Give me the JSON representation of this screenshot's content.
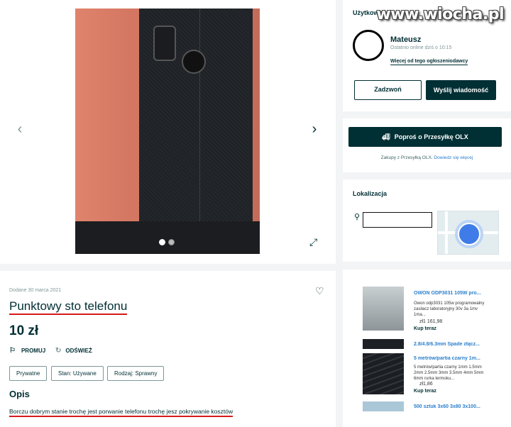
{
  "watermark": "www.wiocha.pl",
  "gallery": {
    "prev_arrow": "‹",
    "next_arrow": "›",
    "expand_icon": "⤢"
  },
  "user": {
    "section_title": "Użytkownik",
    "name": "Mateusz",
    "last_online": "Ostatnio online dziś o 10:15",
    "more_ads_link": "Więcej od tego ogłoszeniodawcy",
    "call_button": "Zadzwoń",
    "message_button": "Wyślij wiadomość"
  },
  "shipping": {
    "button": "Poproś o Przesyłkę OLX",
    "note": "Zakupy z Przesyłką OLX.",
    "note_link": "Dowiedz się więcej"
  },
  "location": {
    "title": "Lokalizacja",
    "address": ""
  },
  "listing": {
    "added_date": "Dodane 30 marca 2021",
    "title": "Punktowy sto telefonu",
    "price": "10 zł",
    "promote_label": "PROMUJ",
    "refresh_label": "ODŚWIEŻ",
    "tags": [
      "Prywatne",
      "Stan: Używane",
      "Rodzaj: Sprawny"
    ],
    "description_heading": "Opis",
    "description": "Borczu dobrym stanie trochę jest porwanie telefonu trochę jesz pokrywanie kosztów"
  },
  "ads": [
    {
      "title": "OWON ODP3031 105W pro...",
      "desc": "Owon odp3031 105w programowalny zasilacz laboratoryjny 30v 3a 1mv 1ma...",
      "price": "zł1 161,98",
      "buy": "Kup teraz"
    },
    {
      "title": "2.8/4.8/6.3mm Spade złącz...",
      "desc": "",
      "price": "",
      "buy": ""
    },
    {
      "title": "5 metrów/partia czarny 1m...",
      "desc": "5 metrów/partia czarny 1mm 1.5mm 2mm 2.5mm 3mm 3.5mm 4mm 5mm 6mm rurka termoku...",
      "price": "zł1,86",
      "buy": "Kup teraz"
    },
    {
      "title": "500 sztuk 3x60 3x80 3x100...",
      "desc": "",
      "price": "",
      "buy": ""
    }
  ]
}
